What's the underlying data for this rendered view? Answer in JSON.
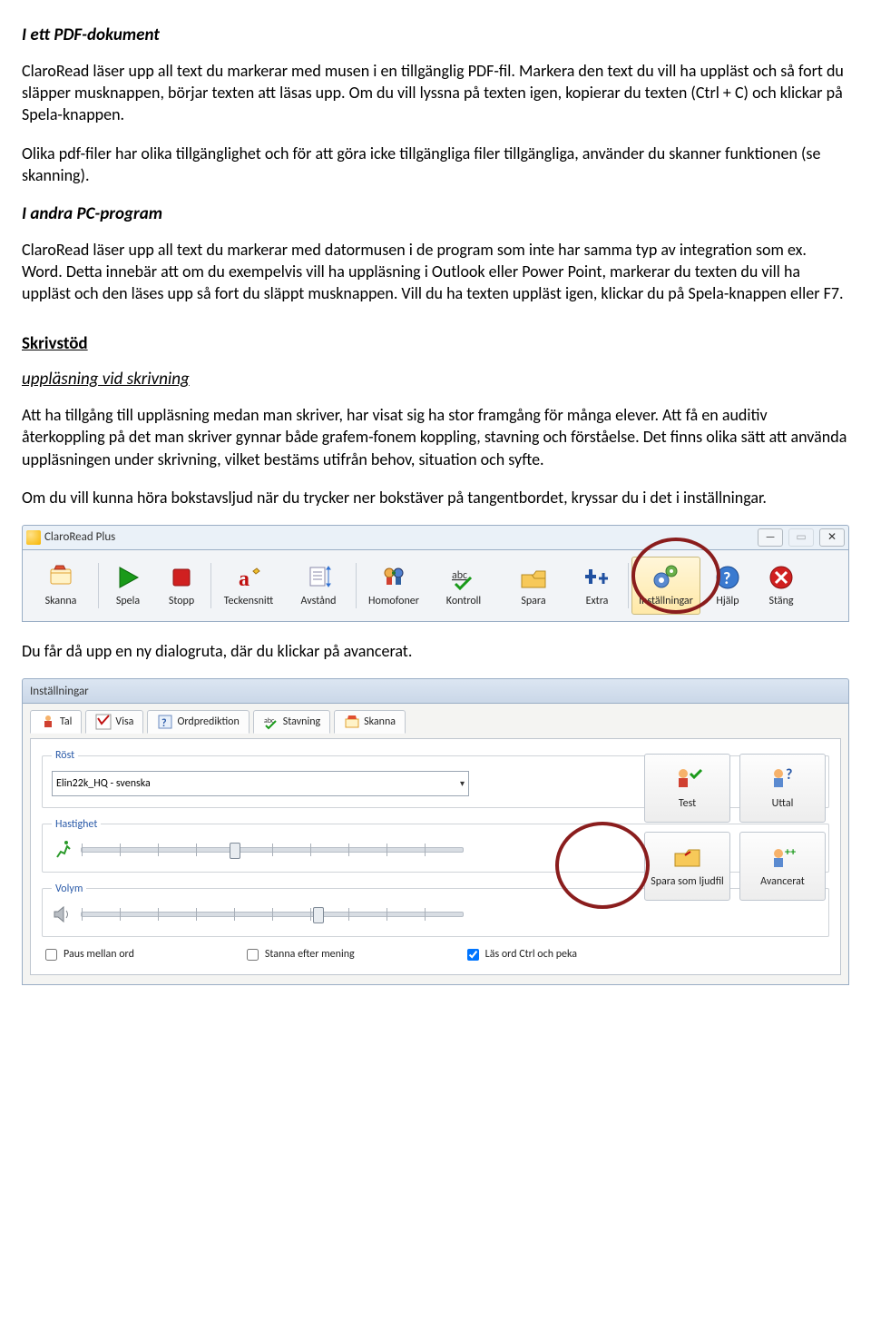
{
  "section1": {
    "heading": "I ett PDF-dokument",
    "p1": "ClaroRead läser upp all text du markerar med musen i en tillgänglig PDF-fil. Markera den text du vill ha uppläst och så fort du släpper musknappen, börjar texten att läsas upp. Om du vill lyssna på texten igen, kopierar du texten (Ctrl + C) och klickar på Spela-knappen.",
    "p2": "Olika pdf-filer har olika tillgänglighet och för att göra icke tillgängliga filer tillgängliga, använder du skanner funktionen (se skanning)."
  },
  "section2": {
    "heading": "I andra PC-program",
    "p1": "ClaroRead läser upp all text du markerar med datormusen i de program som inte har samma typ av integration som ex. Word. Detta innebär att om du exempelvis vill ha uppläsning i Outlook eller Power Point, markerar du texten du vill ha uppläst och den läses upp så fort du släppt musknappen. Vill du ha texten uppläst igen, klickar du på Spela-knappen eller F7."
  },
  "section3": {
    "heading": "Skrivstöd",
    "subheading": "uppläsning vid skrivning",
    "p1": "Att ha tillgång till uppläsning medan man skriver, har visat sig ha stor framgång för många elever. Att få en auditiv återkoppling på det man skriver gynnar både grafem-fonem koppling, stavning och förståelse. Det finns olika sätt att använda uppläsningen under skrivning, vilket bestäms utifrån behov, situation och syfte.",
    "p2": "Om du vill kunna höra bokstavsljud när du trycker ner bokstäver på tangentbordet, kryssar du i det i inställningar."
  },
  "toolbar": {
    "windowTitle": "ClaroRead Plus",
    "buttons": [
      {
        "label": "Skanna"
      },
      {
        "label": "Spela"
      },
      {
        "label": "Stopp"
      },
      {
        "label": "Teckensnitt"
      },
      {
        "label": "Avstånd"
      },
      {
        "label": "Homofoner"
      },
      {
        "label": "Kontroll"
      },
      {
        "label": "Spara"
      },
      {
        "label": "Extra"
      },
      {
        "label": "Inställningar"
      },
      {
        "label": "Hjälp"
      },
      {
        "label": "Stäng"
      }
    ]
  },
  "afterToolbar": "Du får då upp en ny dialogruta, där du klickar på avancerat.",
  "dialog": {
    "title": "Inställningar",
    "tabs": [
      {
        "label": "Tal"
      },
      {
        "label": "Visa"
      },
      {
        "label": "Ordprediktion"
      },
      {
        "label": "Stavning"
      },
      {
        "label": "Skanna"
      }
    ],
    "voice": {
      "legend": "Röst",
      "value": "Elin22k_HQ - svenska"
    },
    "speed": {
      "legend": "Hastighet",
      "thumbPct": 40
    },
    "volume": {
      "legend": "Volym",
      "thumbPct": 62
    },
    "buttons": {
      "test": "Test",
      "uttal": "Uttal",
      "spara": "Spara som ljudfil",
      "avancerat": "Avancerat"
    },
    "checks": {
      "paus": "Paus mellan ord",
      "stanna": "Stanna efter mening",
      "las": "Läs ord Ctrl och peka"
    }
  }
}
